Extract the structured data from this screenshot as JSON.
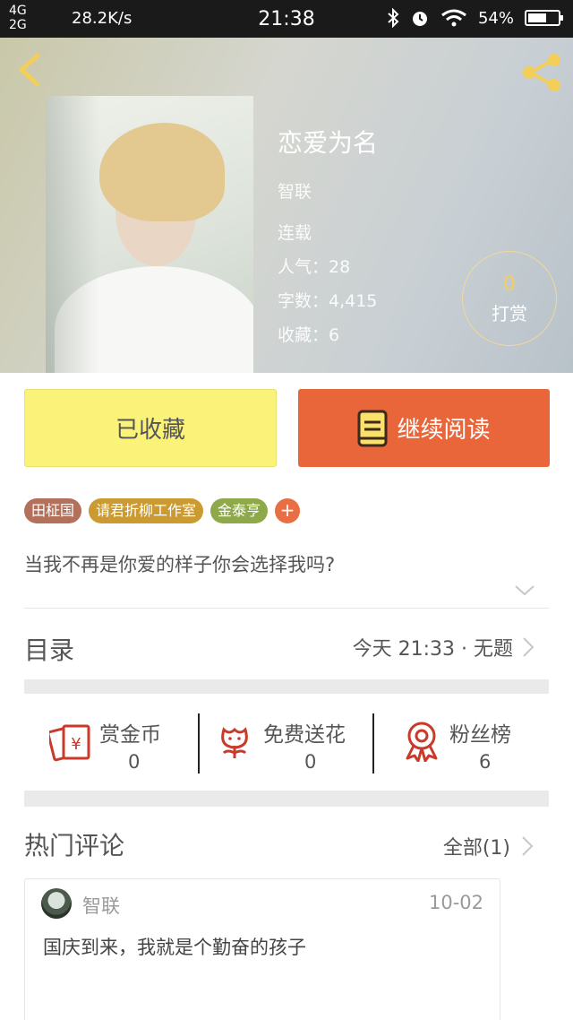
{
  "status_bar": {
    "net_top": "4G",
    "net_bottom": "2G",
    "speed": "28.2K/s",
    "time": "21:38",
    "battery": "54%"
  },
  "book": {
    "title": "恋爱为名",
    "author": "智联",
    "status": "连载",
    "popularity": "人气：28",
    "word_count": "字数：4,415",
    "favorites": "收藏：6",
    "tip_count": "0",
    "tip_label": "打赏"
  },
  "actions": {
    "favorited_label": "已收藏",
    "read_label": "继续阅读"
  },
  "tags": [
    "田柾国",
    "请君折柳工作室",
    "金泰亨"
  ],
  "tag_add": "+",
  "summary": "当我不再是你爱的样子你会选择我吗?",
  "toc": {
    "title": "目录",
    "latest": "今天 21:33 · 无题"
  },
  "stats": {
    "coins_label": "赏金币",
    "coins_value": "0",
    "flowers_label": "免费送花",
    "flowers_value": "0",
    "fans_label": "粉丝榜",
    "fans_value": "6"
  },
  "comments": {
    "title": "热门评论",
    "all_label": "全部(1)",
    "items": [
      {
        "user": "智联",
        "date": "10-02",
        "text": "国庆到来，我就是个勤奋的孩子"
      }
    ]
  },
  "colors": {
    "accent_orange": "#e8663a",
    "favorite_yellow": "#fbf27a",
    "tip_gold": "#f3cf59",
    "icon_red": "#c93a2a"
  }
}
